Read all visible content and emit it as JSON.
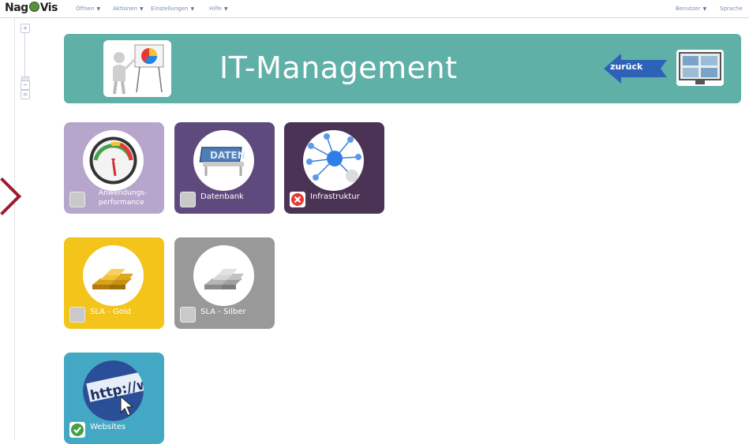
{
  "app": {
    "logo_text_left": "Nag",
    "logo_text_right": "Vis"
  },
  "topbar": {
    "menu": [
      "Öffnen",
      "Aktionen",
      "Einstellungen",
      "Hilfe"
    ],
    "right_menu": [
      "Benutzer",
      "Sprache"
    ]
  },
  "zoom": {
    "plus": "+",
    "minus": "−",
    "fit": "=",
    "level_fraction": 0.85
  },
  "banner": {
    "title": "IT-Management",
    "back_label": "zurück",
    "color": "#5fb0a7"
  },
  "tiles": [
    {
      "label_line1": "Anwendungs-",
      "label_line2": "performance",
      "color": "#b7a6cc",
      "state": "unknown",
      "icon": "gauge-icon"
    },
    {
      "label": "Datenbank",
      "color": "#5f4a7d",
      "state": "unknown",
      "icon": "database-icon"
    },
    {
      "label": "Infrastruktur",
      "color": "#4a3355",
      "state": "critical",
      "icon": "network-icon"
    },
    {
      "label": "SLA - Gold",
      "color": "#f3c41a",
      "state": "unknown",
      "icon": "gold-bars-icon"
    },
    {
      "label": "SLA - Silber",
      "color": "#999999",
      "state": "unknown",
      "icon": "silver-bars-icon"
    },
    {
      "label": "Websites",
      "color": "#43a8c4",
      "state": "ok",
      "icon": "http-icon"
    }
  ],
  "icons": {
    "banner_left": "presentation-icon",
    "banner_back": "back-arrow-icon",
    "banner_right": "monitor-screens-icon"
  }
}
